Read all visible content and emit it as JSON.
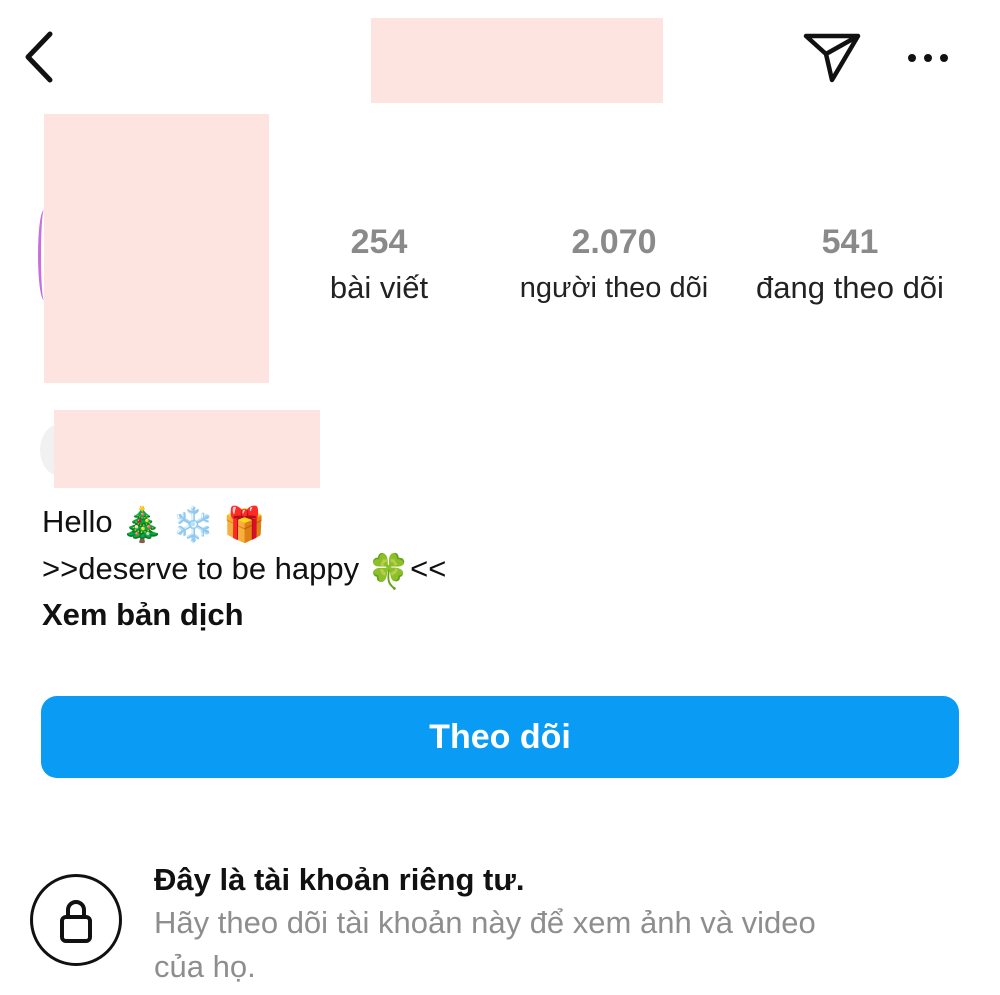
{
  "header": {
    "back_icon": "chevron-left-icon",
    "username": "",
    "direct_icon": "paper-plane-icon",
    "more_icon": "more-horizontal-icon"
  },
  "profile": {
    "avatar": "avatar",
    "stats": [
      {
        "value": "254",
        "label": "bài viết"
      },
      {
        "value": "2.070",
        "label": "người theo dõi"
      },
      {
        "value": "541",
        "label": "đang theo dõi"
      }
    ],
    "display_name": ""
  },
  "bio": {
    "line1_text": "Hello",
    "line1_emojis": [
      "🎄",
      "❄️",
      "🎁"
    ],
    "line2_prefix": ">>deserve to be happy",
    "line2_emoji": "🍀",
    "line2_suffix": "<<",
    "translate_label": "Xem bản dịch"
  },
  "actions": {
    "follow_label": "Theo dõi"
  },
  "private_notice": {
    "icon": "lock-icon",
    "title": "Đây là tài khoản riêng tư.",
    "line1": "Hãy theo dõi tài khoản này để xem ảnh và video",
    "line2": "của họ."
  },
  "colors": {
    "accent": "#0a9bf5",
    "redaction": "#fde4e1"
  }
}
